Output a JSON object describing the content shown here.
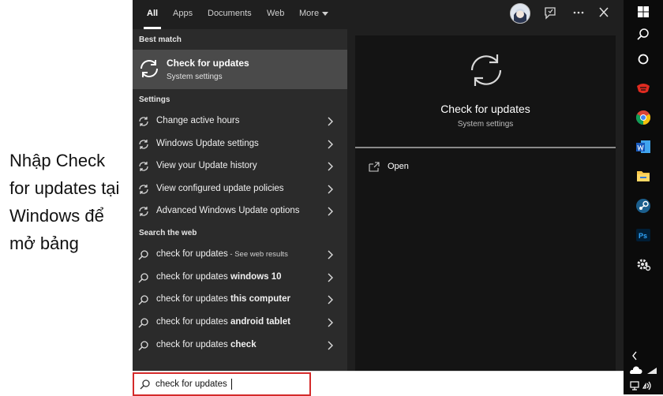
{
  "annotation": {
    "lines": [
      "Nhập Check",
      "for updates tại",
      "Windows để",
      "mở bảng"
    ]
  },
  "tabs": [
    {
      "label": "All",
      "active": true
    },
    {
      "label": "Apps"
    },
    {
      "label": "Documents"
    },
    {
      "label": "Web"
    },
    {
      "label": "More"
    }
  ],
  "top_icons": [
    "user-avatar",
    "feedback-icon",
    "more-options-icon",
    "close-icon"
  ],
  "best_match": {
    "section_label": "Best match",
    "title": "Check for updates",
    "subtitle": "System settings",
    "icon": "sync-icon"
  },
  "settings": {
    "section_label": "Settings",
    "items": [
      {
        "label": "Change active hours"
      },
      {
        "label": "Windows Update settings"
      },
      {
        "label": "View your Update history"
      },
      {
        "label": "View configured update policies"
      },
      {
        "label": "Advanced Windows Update options"
      }
    ]
  },
  "web": {
    "section_label": "Search the web",
    "items": [
      {
        "label": "check for updates",
        "suffix": " - See web results"
      },
      {
        "label": "check for updates",
        "bold": " windows 10"
      },
      {
        "label": "check for updates",
        "bold": " this computer"
      },
      {
        "label": "check for updates",
        "bold": " android tablet"
      },
      {
        "label": "check for updates",
        "bold": " check"
      }
    ]
  },
  "preview": {
    "title": "Check for updates",
    "subtitle": "System settings",
    "action_open": "Open"
  },
  "search": {
    "value": "check for updates"
  },
  "taskbar_icons": [
    "start-icon",
    "search-icon",
    "cortana-icon",
    "garena-icon",
    "chrome-icon",
    "word-icon",
    "file-explorer-icon",
    "steam-icon",
    "photoshop-icon",
    "settings-icon"
  ],
  "tray_icons": [
    "chevron-up-icon",
    "onedrive-icon",
    "network-icon",
    "volume-icon"
  ],
  "colors": {
    "panel": "#1f1f1f",
    "left_column": "#2b2b2b",
    "selected": "#4a4a4a",
    "preview": "#141414",
    "highlight_border": "#d42a2a",
    "taskbar": "#0b0b0b"
  }
}
